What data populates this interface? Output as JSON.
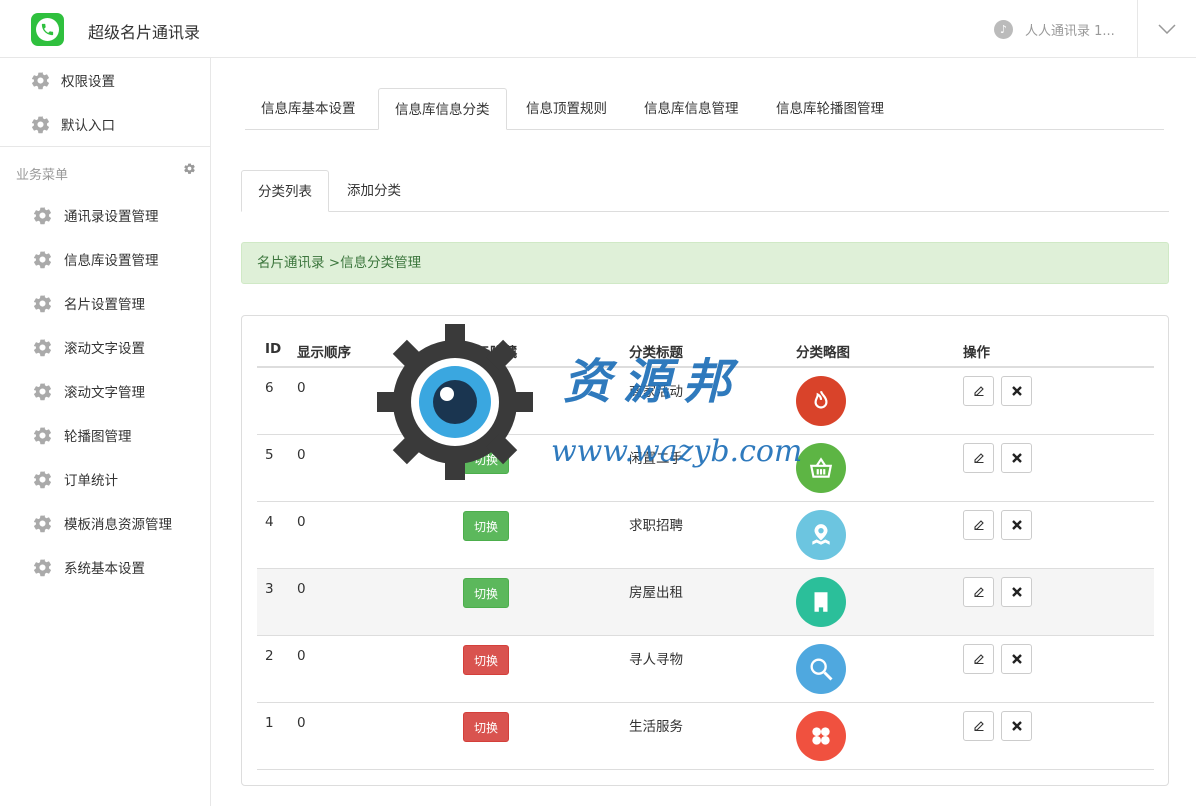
{
  "header": {
    "app_title": "超级名片通讯录",
    "account_name": "人人通讯录 1...",
    "logo_icon": "phone-icon",
    "account_icon": "tiktok-icon",
    "dropdown_icon": "chevron-down-icon"
  },
  "sidebar": {
    "top_items": [
      {
        "label": "权限设置",
        "icon": "gear-icon"
      },
      {
        "label": "默认入口",
        "icon": "gear-icon"
      }
    ],
    "section_title": "业务菜单",
    "items": [
      {
        "label": "通讯录设置管理",
        "icon": "gear-icon"
      },
      {
        "label": "信息库设置管理",
        "icon": "gear-icon"
      },
      {
        "label": "名片设置管理",
        "icon": "gear-icon"
      },
      {
        "label": "滚动文字设置",
        "icon": "gear-icon"
      },
      {
        "label": "滚动文字管理",
        "icon": "gear-icon"
      },
      {
        "label": "轮播图管理",
        "icon": "gear-icon"
      },
      {
        "label": "订单统计",
        "icon": "gear-icon"
      },
      {
        "label": "模板消息资源管理",
        "icon": "gear-icon"
      },
      {
        "label": "系统基本设置",
        "icon": "gear-icon"
      }
    ]
  },
  "tabs": {
    "items": [
      "信息库基本设置",
      "信息库信息分类",
      "信息顶置规则",
      "信息库信息管理",
      "信息库轮播图管理"
    ],
    "active": "信息库信息分类"
  },
  "subtabs": {
    "items": [
      "分类列表",
      "添加分类"
    ],
    "active": "分类列表"
  },
  "breadcrumb": "名片通讯录 >信息分类管理",
  "table": {
    "headers": [
      "ID",
      "显示顺序",
      "显示隐藏",
      "分类标题",
      "分类略图",
      "操作"
    ],
    "toggle_label": "切换",
    "rows": [
      {
        "id": "6",
        "order": "0",
        "toggle": "green",
        "title": "商家活动",
        "icon": "fire-icon",
        "color": "#d9432a"
      },
      {
        "id": "5",
        "order": "0",
        "toggle": "green",
        "title": "闲置二手",
        "icon": "basket-icon",
        "color": "#5db544"
      },
      {
        "id": "4",
        "order": "0",
        "toggle": "green",
        "title": "求职招聘",
        "icon": "map-pin-icon",
        "color": "#6cc5e0"
      },
      {
        "id": "3",
        "order": "0",
        "toggle": "green",
        "title": "房屋出租",
        "icon": "building-icon",
        "color": "#2bbf9a"
      },
      {
        "id": "2",
        "order": "0",
        "toggle": "red",
        "title": "寻人寻物",
        "icon": "search-icon",
        "color": "#4fa8df"
      },
      {
        "id": "1",
        "order": "0",
        "toggle": "red",
        "title": "生活服务",
        "icon": "clover-icon",
        "color": "#f0513f"
      }
    ],
    "edit_icon": "edit-icon",
    "delete_icon": "close-icon"
  },
  "watermark": {
    "text": "资源邦",
    "url": "www.wazyb.com"
  }
}
